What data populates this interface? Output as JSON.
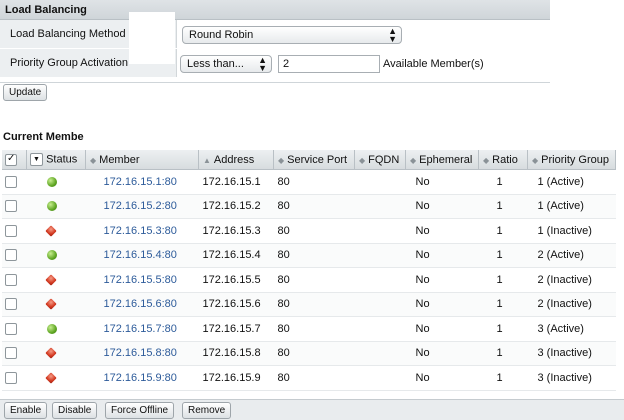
{
  "section": {
    "title": "Load Balancing"
  },
  "properties": {
    "lb_method_label": "Load Balancing Method",
    "lb_method_value": "Round Robin",
    "pga_label": "Priority Group Activation",
    "pga_value": "Less than...",
    "pga_count": "2",
    "pga_suffix": "Available Member(s)"
  },
  "update_label": "Update",
  "members_title": "Current Membe",
  "columns": {
    "status": "Status",
    "member": "Member",
    "address": "Address",
    "port": "Service Port",
    "fqdn": "FQDN",
    "ephemeral": "Ephemeral",
    "ratio": "Ratio",
    "priority": "Priority Group"
  },
  "rows": [
    {
      "status": "active",
      "member": "172.16.15.1:80",
      "address": "172.16.15.1",
      "port": "80",
      "ephemeral": "No",
      "ratio": "1",
      "priority": "1 (Active)"
    },
    {
      "status": "active",
      "member": "172.16.15.2:80",
      "address": "172.16.15.2",
      "port": "80",
      "ephemeral": "No",
      "ratio": "1",
      "priority": "1 (Active)"
    },
    {
      "status": "inactive",
      "member": "172.16.15.3:80",
      "address": "172.16.15.3",
      "port": "80",
      "ephemeral": "No",
      "ratio": "1",
      "priority": "1 (Inactive)"
    },
    {
      "status": "active",
      "member": "172.16.15.4:80",
      "address": "172.16.15.4",
      "port": "80",
      "ephemeral": "No",
      "ratio": "1",
      "priority": "2 (Active)"
    },
    {
      "status": "inactive",
      "member": "172.16.15.5:80",
      "address": "172.16.15.5",
      "port": "80",
      "ephemeral": "No",
      "ratio": "1",
      "priority": "2 (Inactive)"
    },
    {
      "status": "inactive",
      "member": "172.16.15.6:80",
      "address": "172.16.15.6",
      "port": "80",
      "ephemeral": "No",
      "ratio": "1",
      "priority": "2 (Inactive)"
    },
    {
      "status": "active",
      "member": "172.16.15.7:80",
      "address": "172.16.15.7",
      "port": "80",
      "ephemeral": "No",
      "ratio": "1",
      "priority": "3 (Active)"
    },
    {
      "status": "inactive",
      "member": "172.16.15.8:80",
      "address": "172.16.15.8",
      "port": "80",
      "ephemeral": "No",
      "ratio": "1",
      "priority": "3 (Inactive)"
    },
    {
      "status": "inactive",
      "member": "172.16.15.9:80",
      "address": "172.16.15.9",
      "port": "80",
      "ephemeral": "No",
      "ratio": "1",
      "priority": "3 (Inactive)"
    }
  ],
  "actions": {
    "enable": "Enable",
    "disable": "Disable",
    "force_offline": "Force Offline",
    "remove": "Remove"
  },
  "colors": {
    "link": "#2d5b9a",
    "active": "#5ea522",
    "inactive": "#d43a22"
  }
}
